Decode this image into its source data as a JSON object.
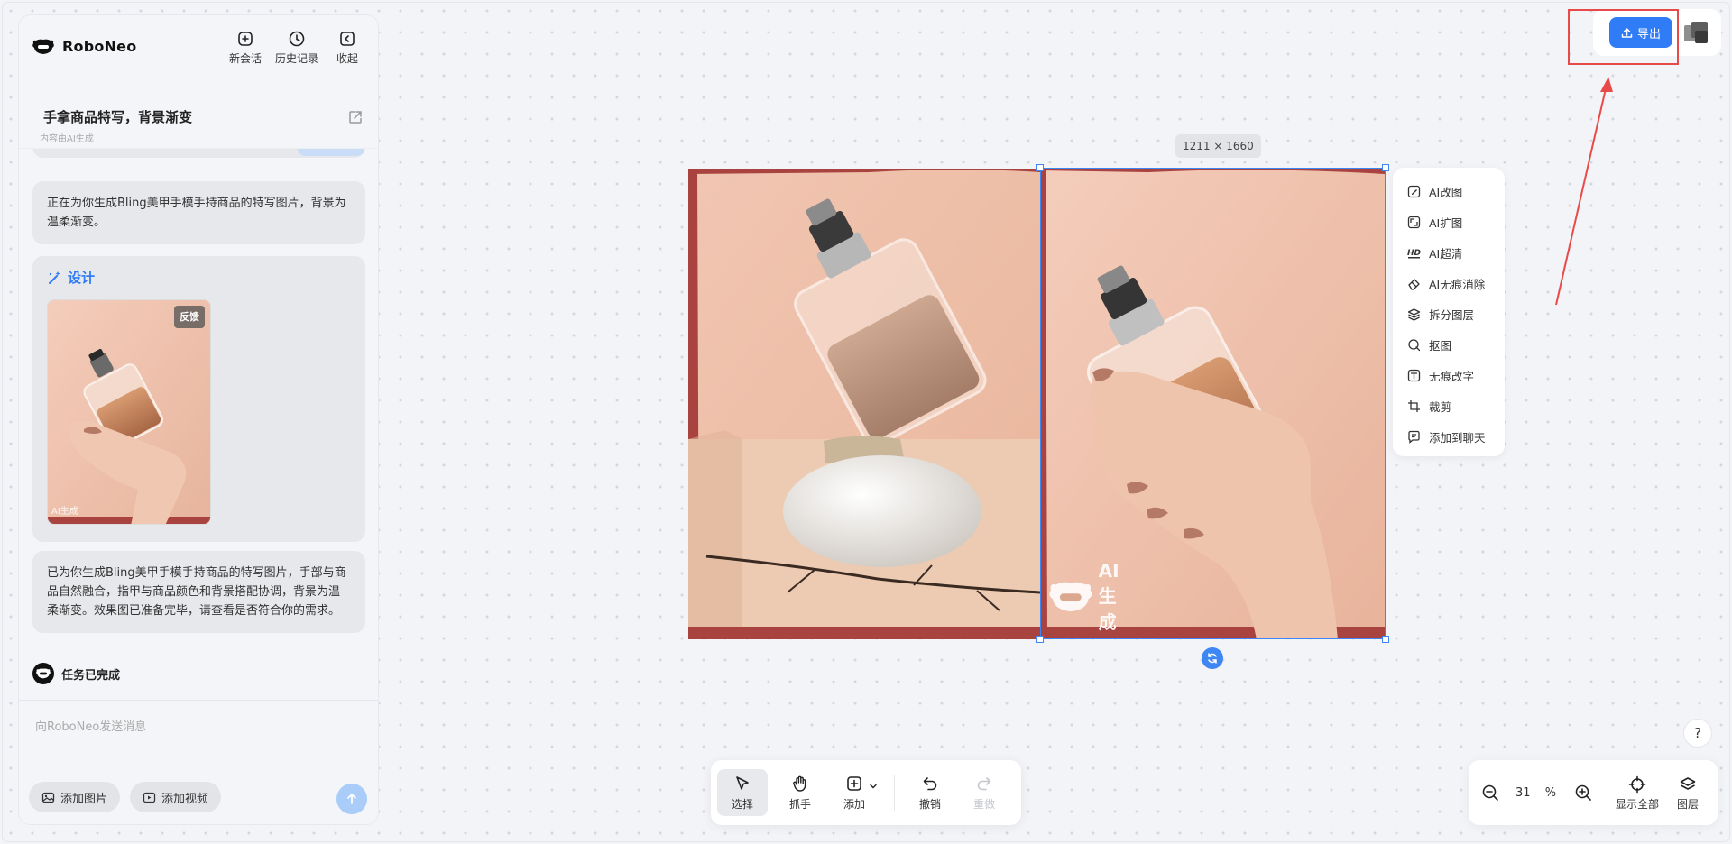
{
  "app": {
    "name": "RoboNeo"
  },
  "header": {
    "new_chat": "新会话",
    "history": "历史记录",
    "collapse": "收起"
  },
  "conversation": {
    "title": "手拿商品特写，背景渐变",
    "subtitle": "内容由AI生成"
  },
  "messages": {
    "intro": "正在为你生成Bling美甲手模手持商品的特写图片，背景为温柔渐变。",
    "design_label": "设计",
    "feedback": "反馈",
    "thumb_watermark": "AI生成",
    "result": "已为你生成Bling美甲手模手持商品的特写图片，手部与商品自然融合，指甲与商品颜色和背景搭配协调，背景为温柔渐变。效果图已准备完毕，请查看是否符合你的需求。",
    "status": "任务已完成"
  },
  "input": {
    "placeholder": "向RoboNeo发送消息",
    "add_image": "添加图片",
    "add_video": "添加视频"
  },
  "canvas": {
    "dimension_badge": "1211 × 1660",
    "watermark": "AI生成"
  },
  "context_menu": [
    {
      "label": "AI改图",
      "icon": "edit-image-icon"
    },
    {
      "label": "AI扩图",
      "icon": "expand-image-icon"
    },
    {
      "label": "AI超清",
      "icon": "hd-icon"
    },
    {
      "label": "AI无痕消除",
      "icon": "eraser-icon"
    },
    {
      "label": "拆分图层",
      "icon": "layers-icon"
    },
    {
      "label": "抠图",
      "icon": "cutout-icon"
    },
    {
      "label": "无痕改字",
      "icon": "text-edit-icon"
    },
    {
      "label": "裁剪",
      "icon": "crop-icon"
    },
    {
      "label": "添加到聊天",
      "icon": "chat-add-icon"
    }
  ],
  "top_right": {
    "export": "导出"
  },
  "toolbar": {
    "select": "选择",
    "hand": "抓手",
    "add": "添加",
    "undo": "撤销",
    "redo": "重做"
  },
  "zoom": {
    "value": "31",
    "unit": "%",
    "fit_all": "显示全部",
    "layers": "图层"
  },
  "help": "?",
  "colors": {
    "accent": "#2f7cf6",
    "annotation_red": "#e84a4a",
    "image_background": "#f2c9b4",
    "image_border": "#a8433f"
  }
}
